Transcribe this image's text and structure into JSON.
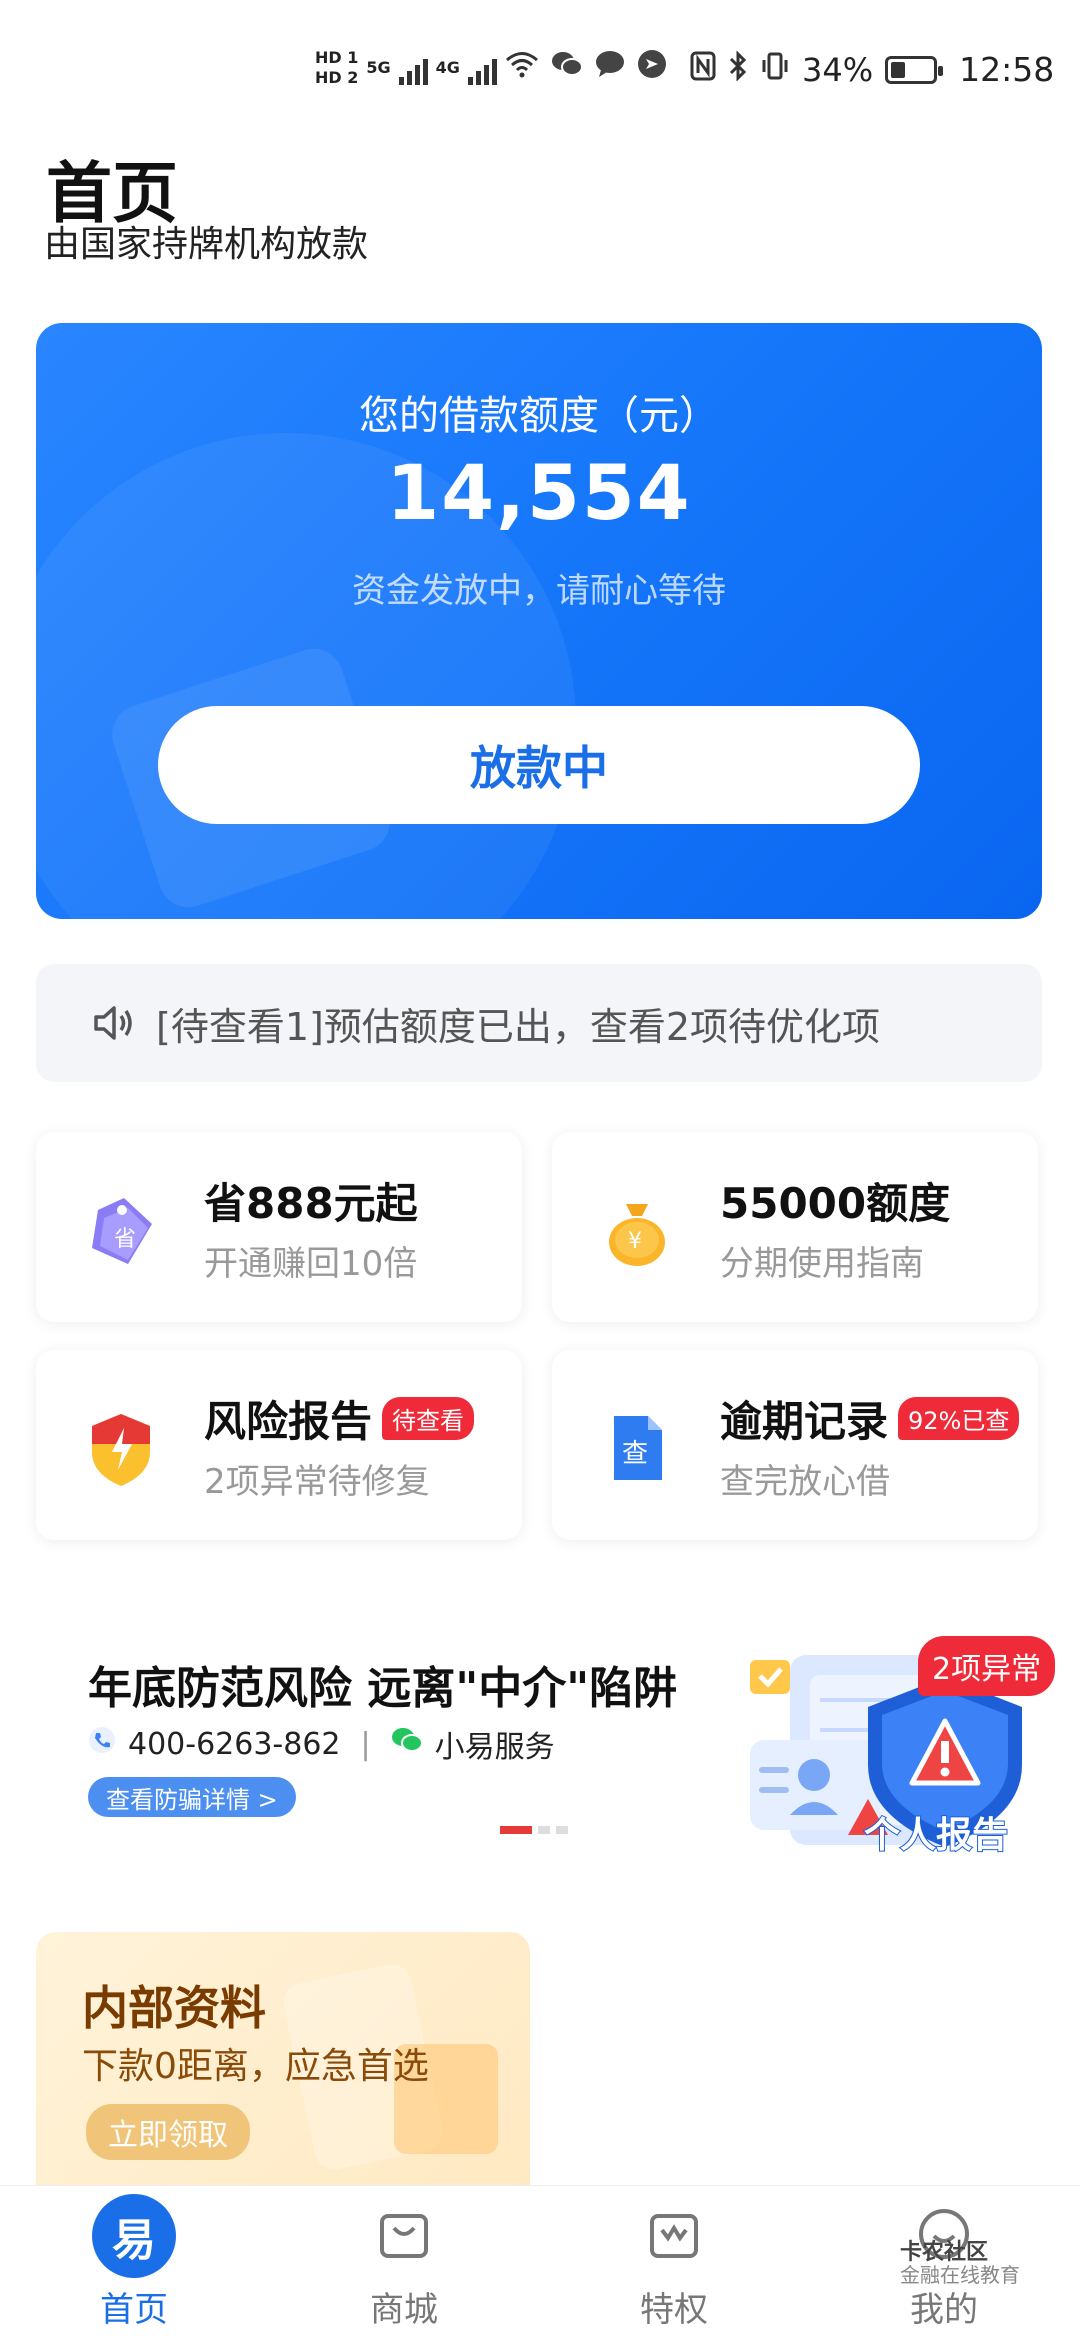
{
  "status_bar": {
    "hd1": "HD 1",
    "hd2": "HD 2",
    "net1": "5G",
    "net2": "4G",
    "battery": "34%",
    "time": "12:58"
  },
  "header": {
    "title": "首页",
    "subtitle": "由国家持牌机构放款"
  },
  "loan_card": {
    "label": "您的借款额度（元）",
    "amount": "14,554",
    "status": "资金发放中，请耐心等待",
    "button": "放款中"
  },
  "notice": {
    "text": "[待查看1]预估额度已出，查看2项待优化项"
  },
  "features": [
    {
      "title": "省888元起",
      "subtitle": "开通赚回10倍",
      "icon": "discount-tag-icon",
      "badge": ""
    },
    {
      "title": "55000额度",
      "subtitle": "分期使用指南",
      "icon": "money-bag-icon",
      "badge": ""
    },
    {
      "title": "风险报告",
      "subtitle": "2项异常待修复",
      "icon": "risk-shield-icon",
      "badge": "待查看"
    },
    {
      "title": "逾期记录",
      "subtitle": "查完放心借",
      "icon": "check-document-icon",
      "badge": "92%已查"
    }
  ],
  "banner": {
    "title": "年底防范风险  远离\"中介\"陷阱",
    "phone": "400-6263-862",
    "separator": "|",
    "wechat": "小易服务",
    "button": "查看防骗详情 >",
    "badge": "2项异常",
    "report_label": "个人报告"
  },
  "promo": {
    "title": "内部资料",
    "subtitle": "下款0距离，应急首选",
    "button": "立即领取"
  },
  "tabs": [
    {
      "label": "首页",
      "icon_text": "易",
      "icon": "home-icon"
    },
    {
      "label": "商城",
      "icon": "shopping-bag-icon"
    },
    {
      "label": "特权",
      "icon": "privilege-icon"
    },
    {
      "label": "我的",
      "icon": "profile-icon"
    }
  ],
  "watermark": {
    "line1": "卡农社区",
    "line2": "金融在线教育"
  },
  "colors": {
    "primary": "#1a6fe8",
    "danger": "#ef2b3a",
    "promo_bg": "#ffe9c2"
  }
}
